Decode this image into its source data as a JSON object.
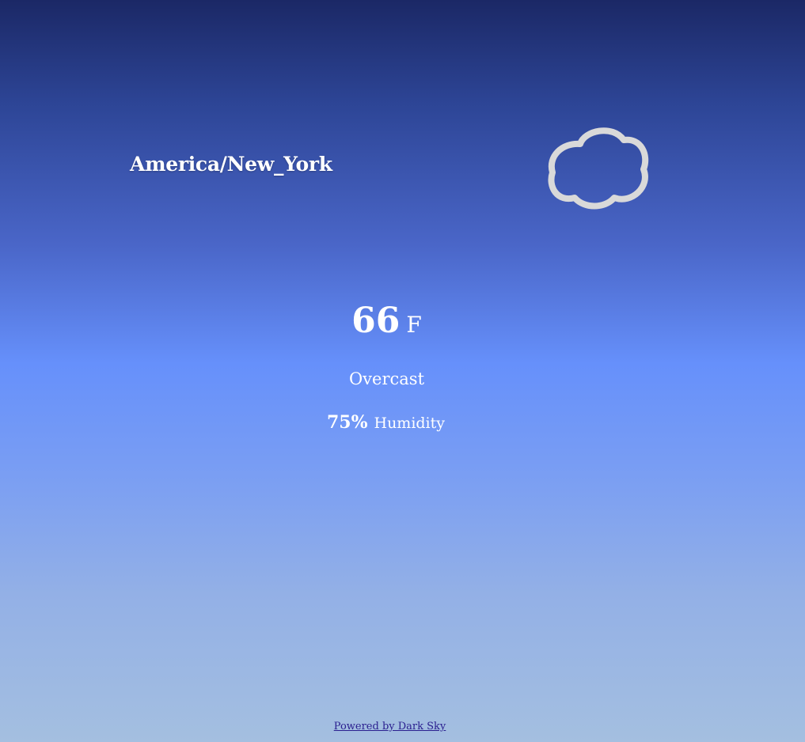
{
  "location": {
    "timezone": "America/New_York"
  },
  "current": {
    "temperature": "66",
    "unit": "F",
    "summary": "Overcast",
    "humidity_value": "75%",
    "humidity_label": "Humidity",
    "icon": "cloud-icon"
  },
  "footer": {
    "powered_by": "Powered by Dark Sky"
  },
  "colors": {
    "gradient_top": "#1b2866",
    "gradient_middle": "#6690fb",
    "gradient_bottom": "#a4bfe0",
    "icon_stroke": "#d9d9d9",
    "link": "#2a1f8f"
  }
}
